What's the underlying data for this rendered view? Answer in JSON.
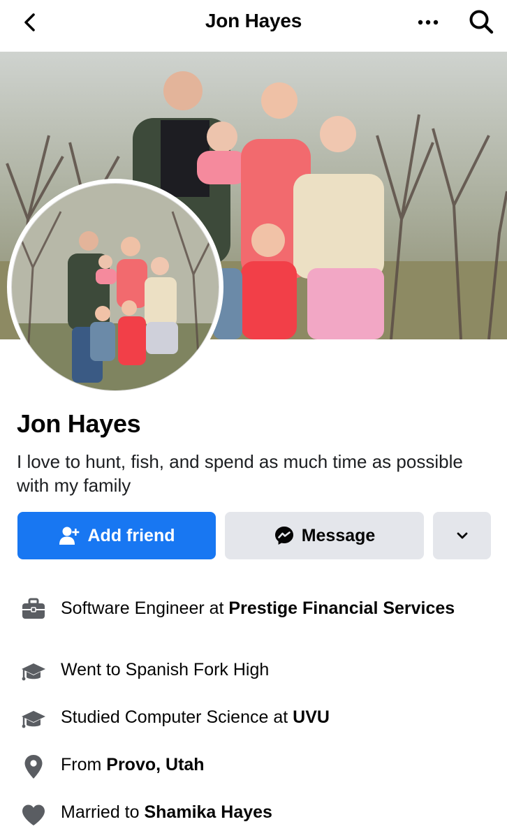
{
  "header": {
    "title": "Jon Hayes"
  },
  "profile": {
    "name": "Jon Hayes",
    "bio": "I love to hunt, fish, and spend as much time as possible with my family"
  },
  "actions": {
    "add_friend_label": "Add friend",
    "message_label": "Message"
  },
  "details": {
    "work_prefix": "Software Engineer at ",
    "work_company": "Prestige Financial Services",
    "school_prefix": "Went to ",
    "school_name": "Spanish Fork High",
    "study_prefix": "Studied Computer Science at ",
    "study_school": "UVU",
    "from_prefix": "From ",
    "from_place": "Provo, Utah",
    "married_prefix": "Married to ",
    "married_name": "Shamika Hayes"
  },
  "colors": {
    "primary": "#1877f2",
    "secondary_button": "#e4e6eb",
    "icon": "#5a5d62"
  },
  "icons": [
    "back-arrow-icon",
    "more-dots-icon",
    "search-icon",
    "add-person-icon",
    "messenger-icon",
    "chevron-down-icon",
    "briefcase-icon",
    "graduation-cap-icon",
    "location-pin-icon",
    "heart-icon"
  ]
}
